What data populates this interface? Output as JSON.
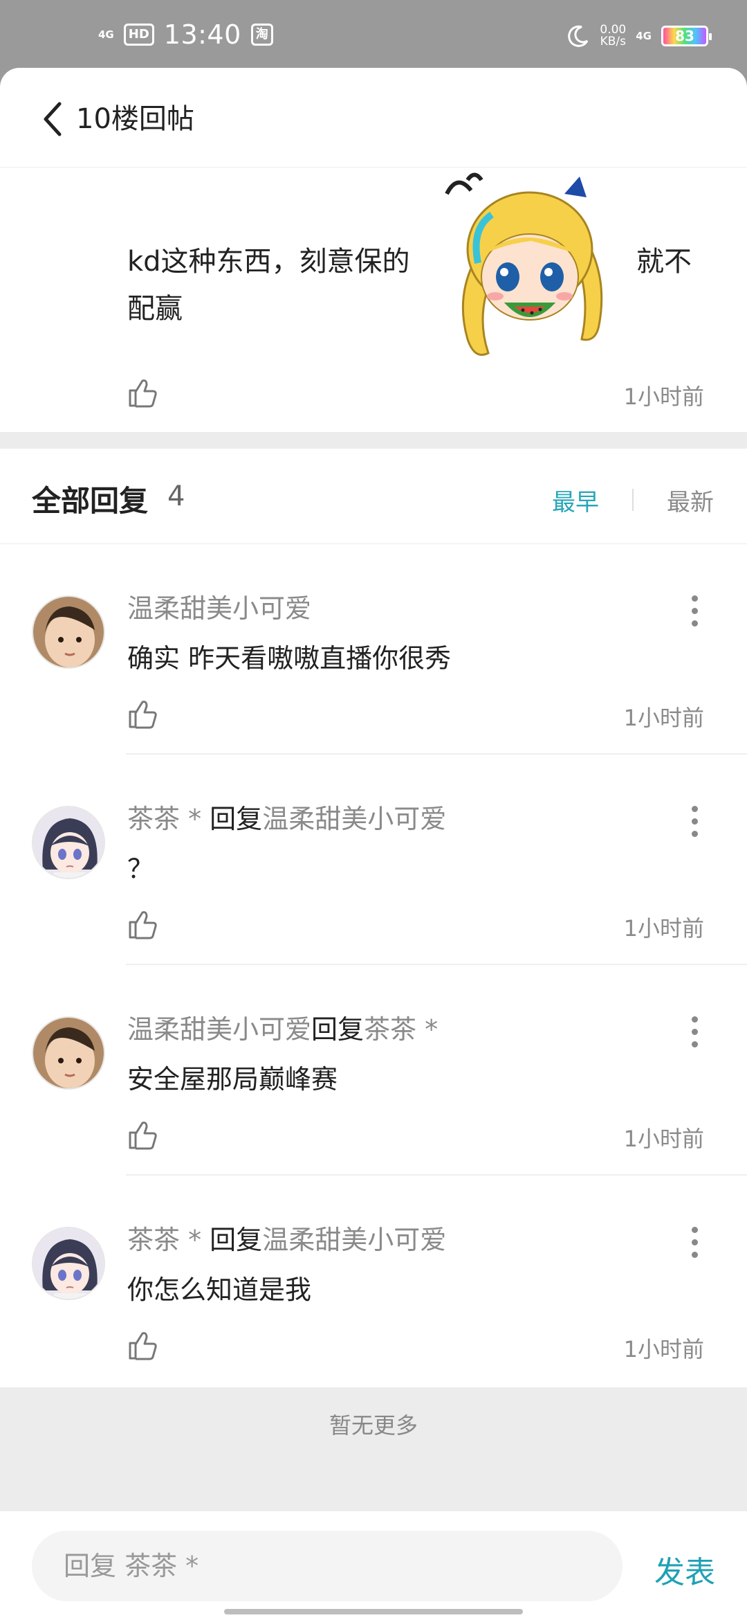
{
  "status_bar": {
    "network_left": "4G",
    "hd": "HD",
    "time": "13:40",
    "taobao": "淘",
    "speed_value": "0.00",
    "speed_unit": "KB/s",
    "network_right": "4G",
    "battery": "83"
  },
  "header": {
    "title": "10楼回帖"
  },
  "main_post": {
    "text_before": "kd这种东西，刻意保的",
    "text_after": "就不",
    "text_line2": "配赢",
    "time": "1小时前"
  },
  "replies_section": {
    "title": "全部回复",
    "count": "4",
    "sort_earliest": "最早",
    "sort_newest": "最新"
  },
  "replies": [
    {
      "author": "温柔甜美小可爱",
      "reply_word": "",
      "target": "",
      "content": "确实 昨天看嗷嗷直播你很秀",
      "time": "1小时前"
    },
    {
      "author": "茶茶 * ",
      "reply_word": "回复",
      "target": "温柔甜美小可爱",
      "content": "？",
      "time": "1小时前"
    },
    {
      "author": "温柔甜美小可爱",
      "reply_word": "回复",
      "target": "茶茶 *",
      "content": "安全屋那局巅峰赛",
      "time": "1小时前"
    },
    {
      "author": "茶茶 * ",
      "reply_word": "回复",
      "target": "温柔甜美小可爱",
      "content": "你怎么知道是我",
      "time": "1小时前"
    }
  ],
  "footer": {
    "no_more": "暂无更多"
  },
  "input_bar": {
    "placeholder": "回复 茶茶 *",
    "send_label": "发表"
  }
}
